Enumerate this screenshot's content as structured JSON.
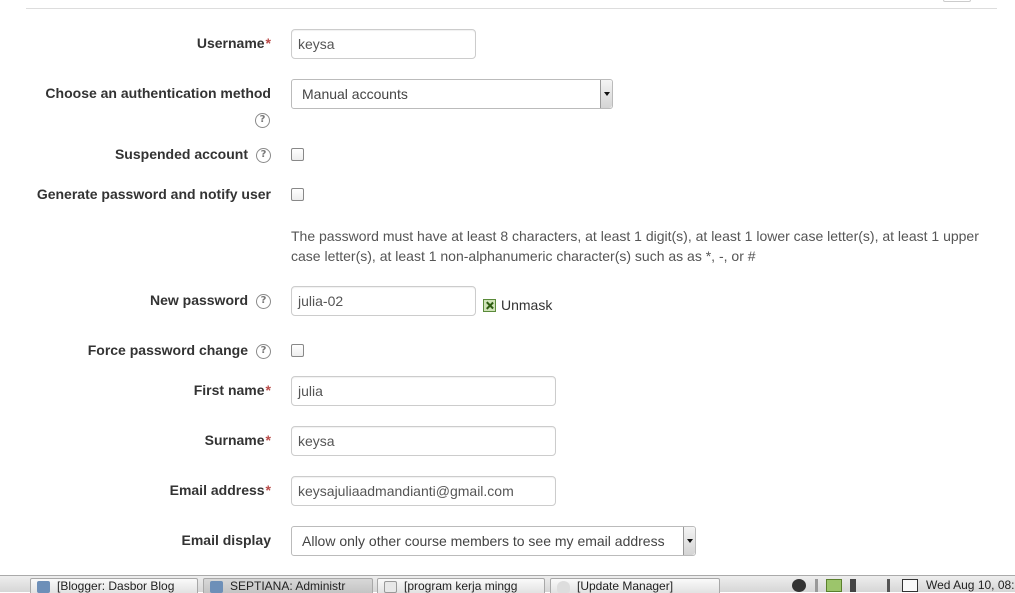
{
  "form": {
    "username": {
      "label": "Username",
      "required": "*",
      "value": "keysa"
    },
    "auth": {
      "label": "Choose an authentication method",
      "value": "Manual accounts"
    },
    "suspended": {
      "label": "Suspended account"
    },
    "generate": {
      "label": "Generate password and notify user"
    },
    "password_policy": "The password must have at least 8 characters, at least 1 digit(s), at least 1 lower case letter(s), at least 1 upper case letter(s), at least 1 non-alphanumeric character(s) such as as *, -, or #",
    "new_password": {
      "label": "New password",
      "value": "julia-02",
      "unmask_label": "Unmask"
    },
    "force_change": {
      "label": "Force password change"
    },
    "firstname": {
      "label": "First name",
      "required": "*",
      "value": "julia"
    },
    "surname": {
      "label": "Surname",
      "required": "*",
      "value": "keysa"
    },
    "email": {
      "label": "Email address",
      "required": "*",
      "value": "keysajuliaadmandianti@gmail.com"
    },
    "email_display": {
      "label": "Email display",
      "value": "Allow only other course members to see my email address"
    },
    "help_glyph": "?"
  },
  "taskbar": {
    "tasks": [
      {
        "label": "[Blogger: Dasbor Blog",
        "icon": "browser-icon"
      },
      {
        "label": "SEPTIANA: Administr",
        "icon": "browser-icon"
      },
      {
        "label": "[program kerja mingg",
        "icon": "document-icon"
      },
      {
        "label": "[Update Manager]",
        "icon": "shield-icon"
      }
    ],
    "clock": "Wed Aug 10, 08:"
  },
  "colors": {
    "required": "#b94a48",
    "label": "#333333",
    "muted": "#555555"
  }
}
